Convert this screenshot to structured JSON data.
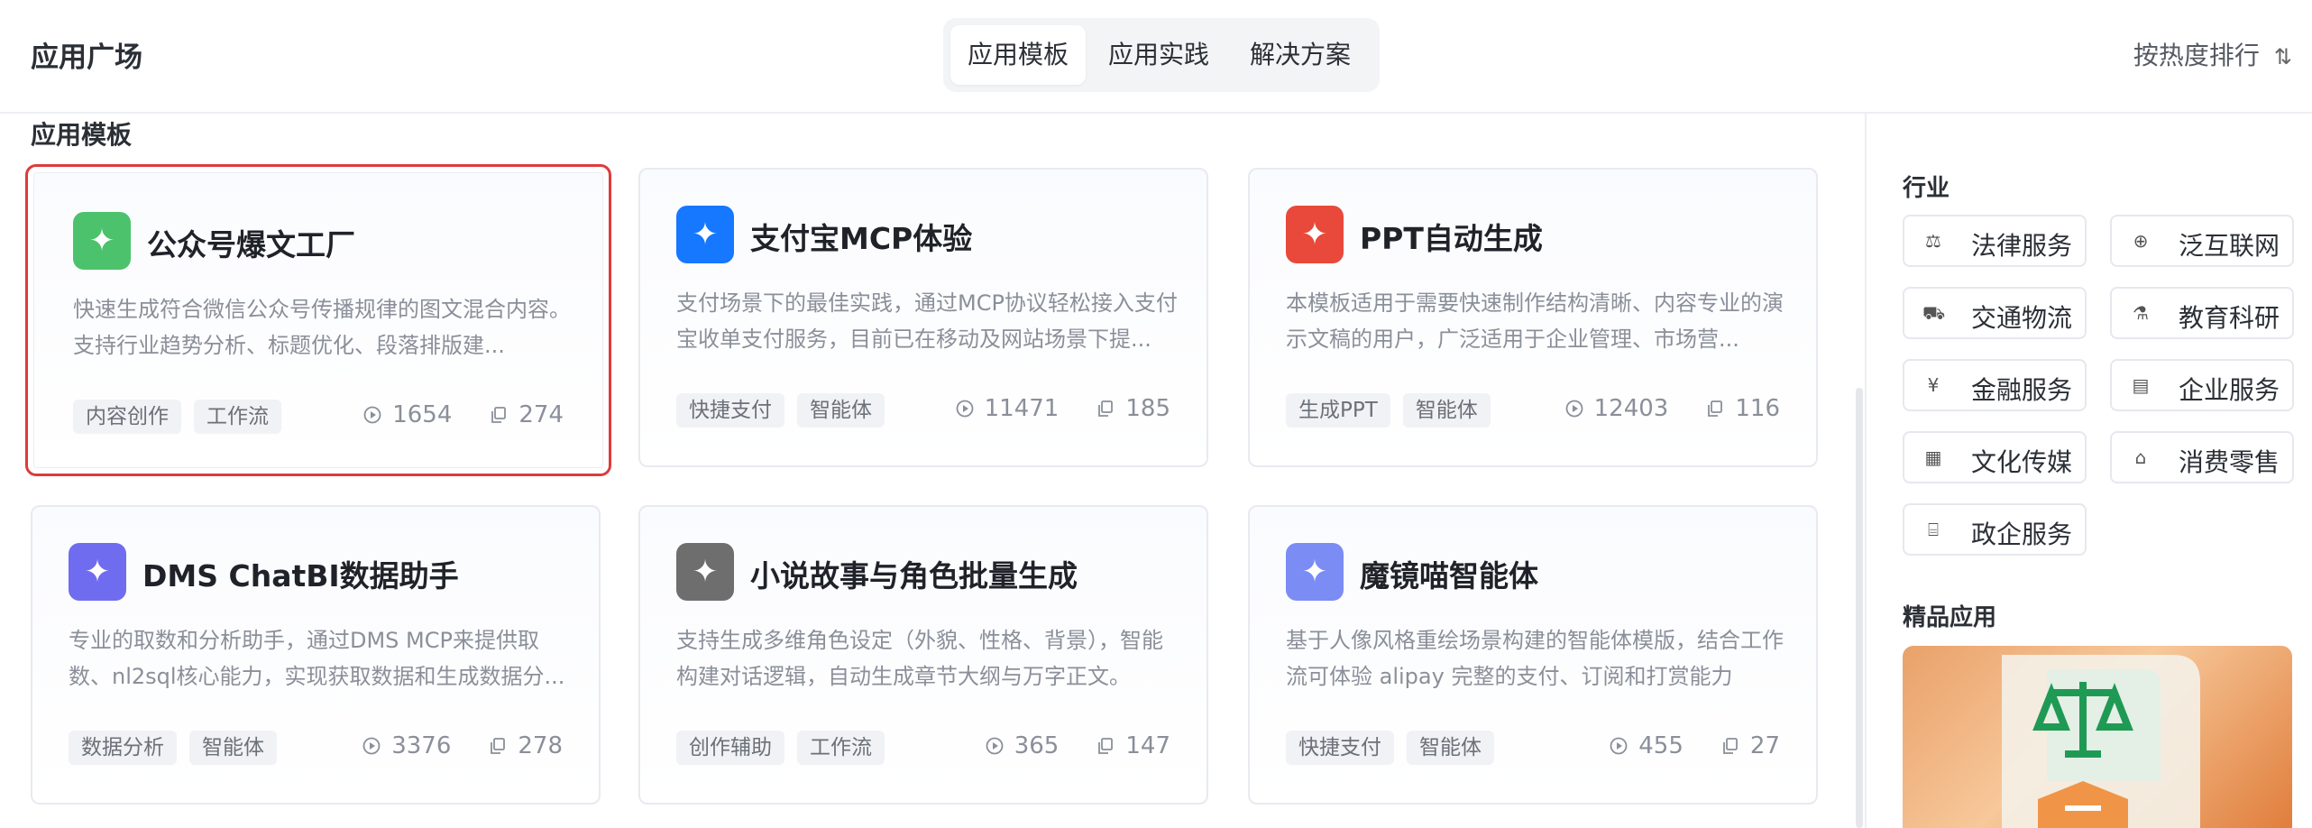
{
  "header": {
    "title": "应用广场",
    "tabs": [
      {
        "label": "应用模板",
        "active": true
      },
      {
        "label": "应用实践",
        "active": false
      },
      {
        "label": "解决方案",
        "active": false
      }
    ],
    "sort_label": "按热度排行",
    "sort_icon": "sort-icon"
  },
  "section_title": "应用模板",
  "cards": [
    {
      "name": "公众号爆文工厂",
      "desc": "快速生成符合微信公众号传播规律的图文混合内容。支持行业趋势分析、标题优化、段落排版建...",
      "tags": [
        "内容创作",
        "工作流"
      ],
      "runs": "1654",
      "copies": "274",
      "logo_color": "#4cc26c",
      "selected": true
    },
    {
      "name": "支付宝MCP体验",
      "desc": "支付场景下的最佳实践，通过MCP协议轻松接入支付宝收单支付服务，目前已在移动及网站场景下提...",
      "tags": [
        "快捷支付",
        "智能体"
      ],
      "runs": "11471",
      "copies": "185",
      "logo_color": "#1677ff"
    },
    {
      "name": "PPT自动生成",
      "desc": "本模板适用于需要快速制作结构清晰、内容专业的演示文稿的用户，广泛适用于企业管理、市场营...",
      "tags": [
        "生成PPT",
        "智能体"
      ],
      "runs": "12403",
      "copies": "116",
      "logo_color": "#e8493a"
    },
    {
      "name": "DMS ChatBI数据助手",
      "desc": "专业的取数和分析助手，通过DMS MCP来提供取数、nl2sql核心能力，实现获取数据和生成数据分...",
      "tags": [
        "数据分析",
        "智能体"
      ],
      "runs": "3376",
      "copies": "278",
      "logo_color": "#6f6cf0"
    },
    {
      "name": "小说故事与角色批量生成",
      "desc": "支持生成多维角色设定（外貌、性格、背景），智能构建对话逻辑，自动生成章节大纲与万字正文。",
      "tags": [
        "创作辅助",
        "工作流"
      ],
      "runs": "365",
      "copies": "147",
      "logo_color": "#6e6e6e"
    },
    {
      "name": "魔镜喵智能体",
      "desc": "基于人像风格重绘场景构建的智能体模版，结合工作流可体验 alipay 完整的支付、订阅和打赏能力",
      "tags": [
        "快捷支付",
        "智能体"
      ],
      "runs": "455",
      "copies": "27",
      "logo_color": "#7b8cf5"
    }
  ],
  "sidebar": {
    "industry_heading": "行业",
    "industries": [
      {
        "label": "法律服务",
        "icon": "scale-icon",
        "glyph": "⚖"
      },
      {
        "label": "泛互联网",
        "icon": "globe-icon",
        "glyph": "⊕"
      },
      {
        "label": "交通物流",
        "icon": "car-icon",
        "glyph": "⛟"
      },
      {
        "label": "教育科研",
        "icon": "flask-icon",
        "glyph": "⚗"
      },
      {
        "label": "金融服务",
        "icon": "coin-icon",
        "glyph": "¥"
      },
      {
        "label": "企业服务",
        "icon": "building-icon",
        "glyph": "▤"
      },
      {
        "label": "文化传媒",
        "icon": "book-icon",
        "glyph": "▦"
      },
      {
        "label": "消费零售",
        "icon": "store-icon",
        "glyph": "⌂"
      },
      {
        "label": "政企服务",
        "icon": "government-icon",
        "glyph": "⌸"
      }
    ],
    "featured_heading": "精品应用"
  }
}
